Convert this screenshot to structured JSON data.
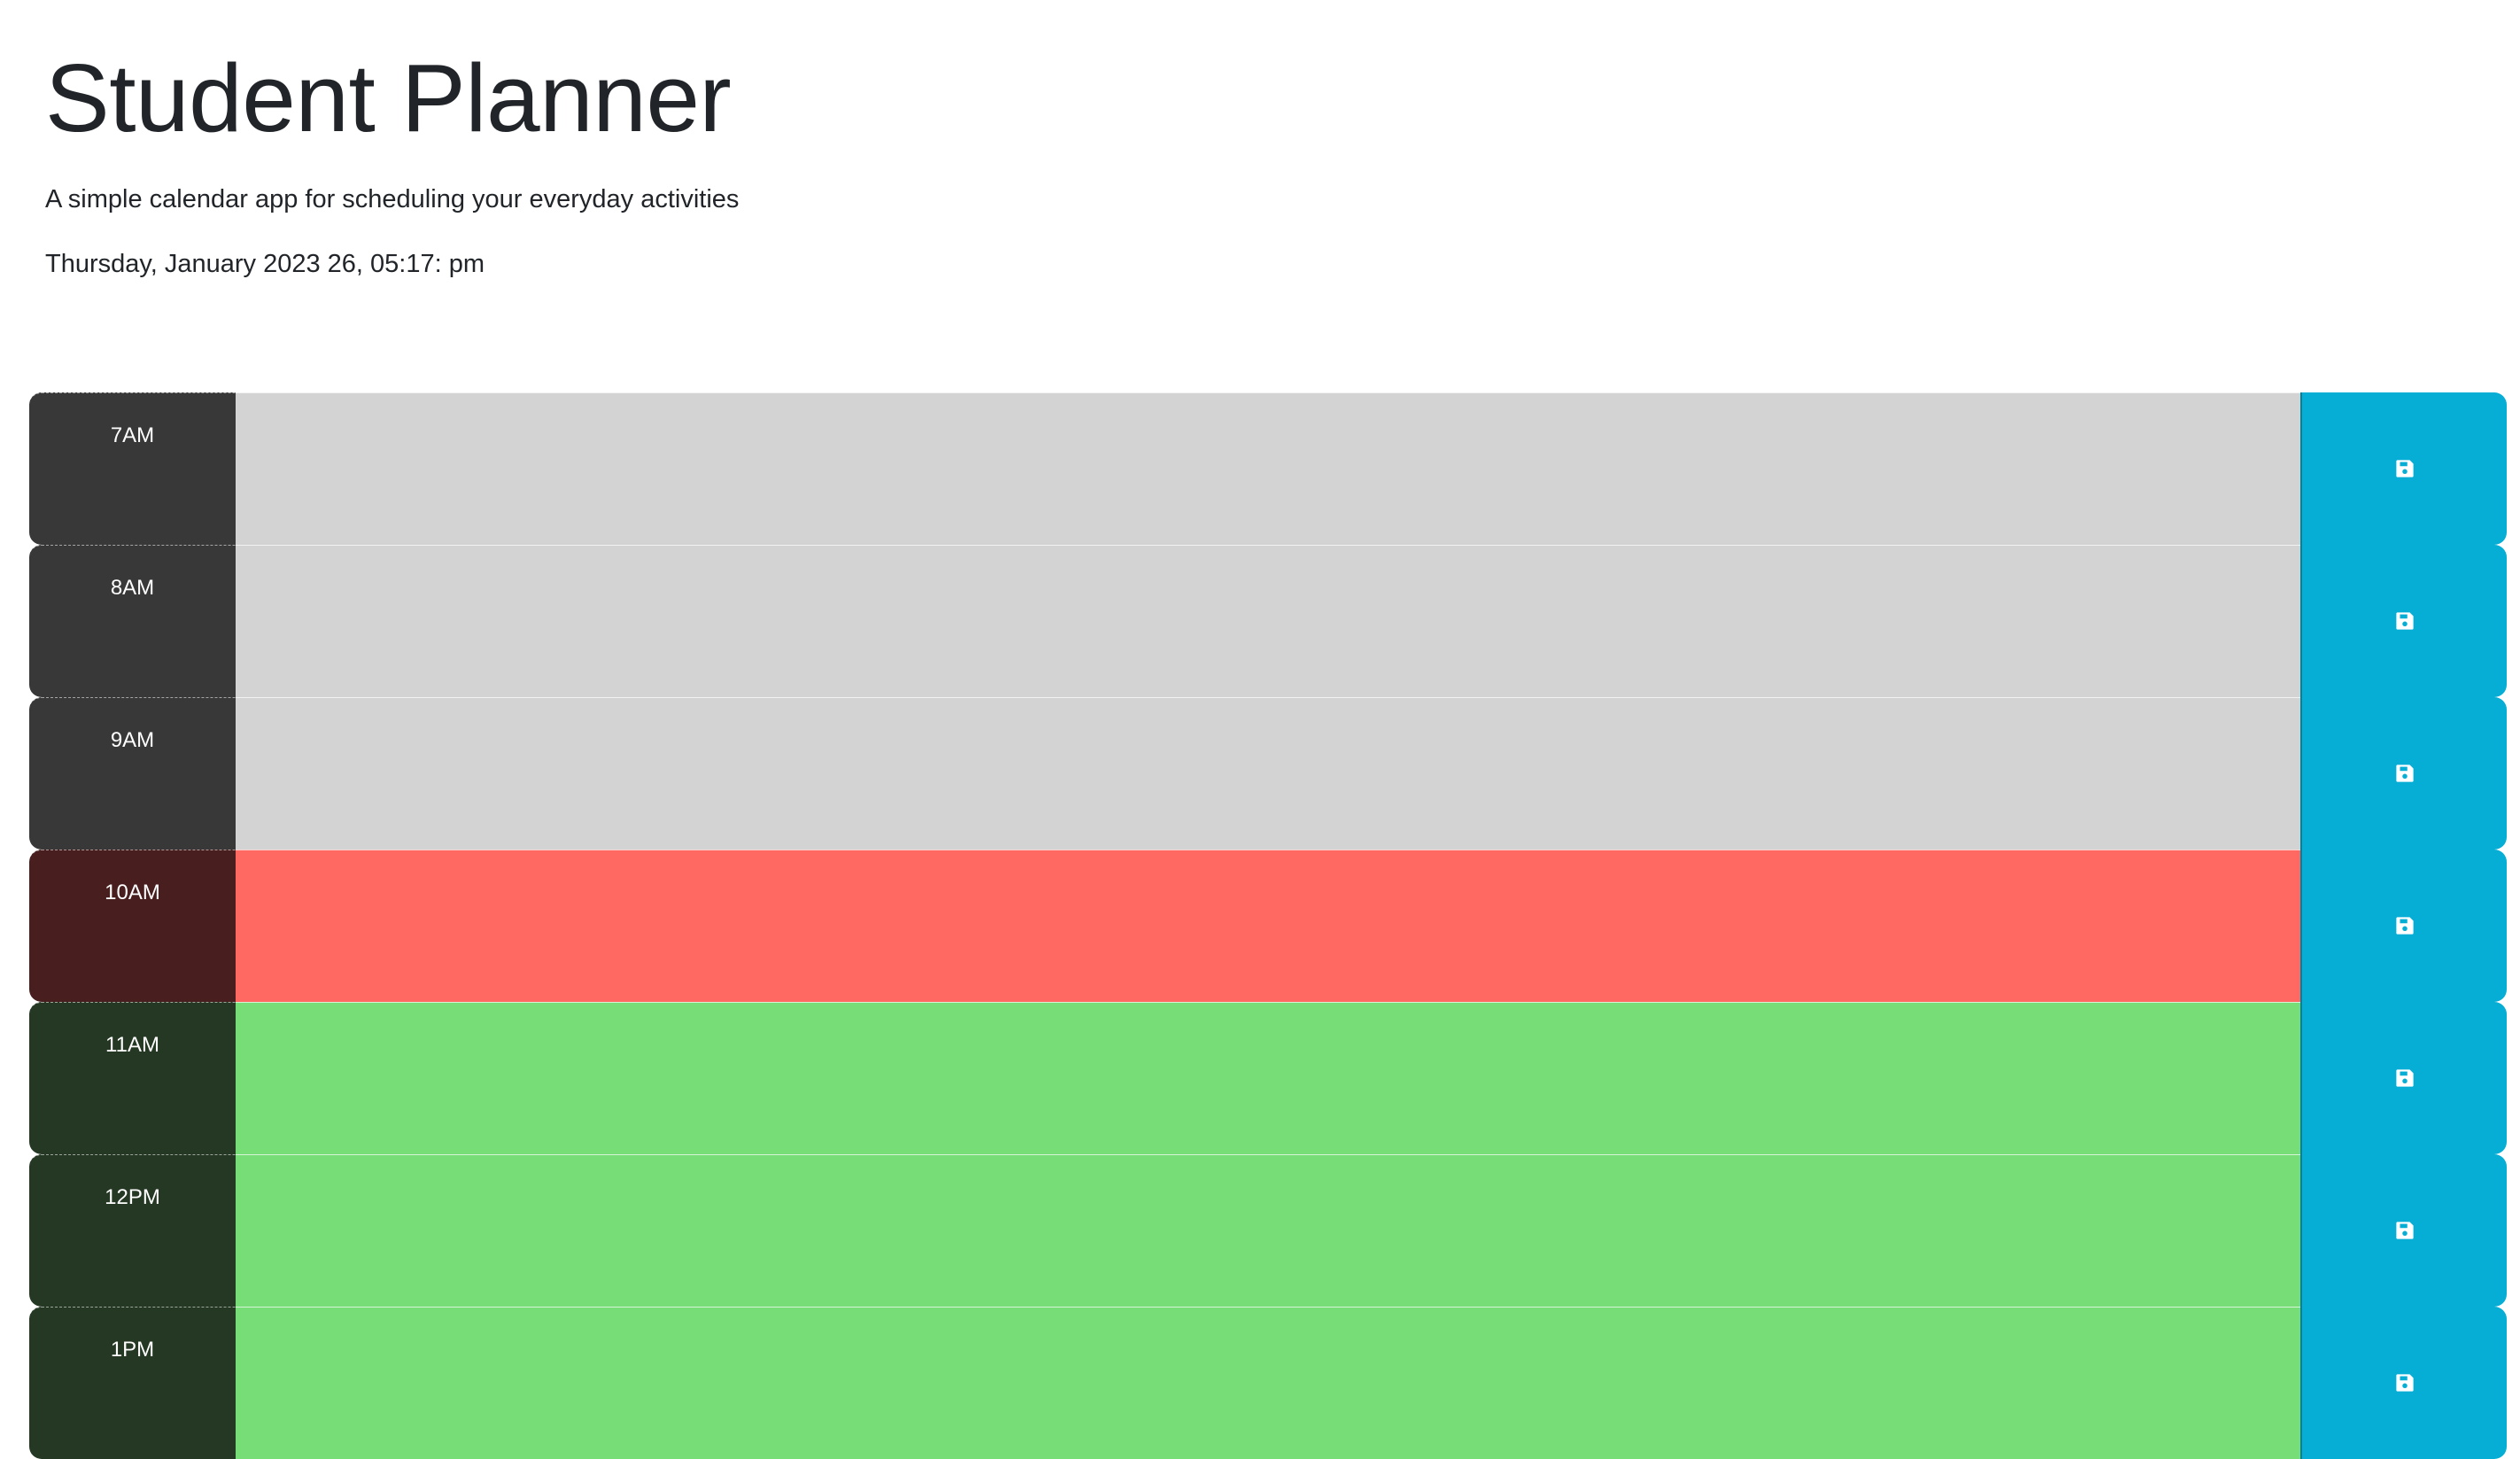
{
  "header": {
    "title": "Student Planner",
    "subtitle": "A simple calendar app for scheduling your everyday activities",
    "datetime": "Thursday, January 2023 26, 05:17: pm"
  },
  "colors": {
    "past": "#d3d3d3",
    "present": "#ff6961",
    "future": "#77dd77",
    "save_button": "#06aed5",
    "hour_past": "#383838",
    "hour_present": "#481f1e",
    "hour_future": "#243823"
  },
  "save_icon": "floppy-disk-icon",
  "time_blocks": [
    {
      "hour": "7AM",
      "state": "past",
      "text": ""
    },
    {
      "hour": "8AM",
      "state": "past",
      "text": ""
    },
    {
      "hour": "9AM",
      "state": "past",
      "text": ""
    },
    {
      "hour": "10AM",
      "state": "present",
      "text": ""
    },
    {
      "hour": "11AM",
      "state": "future",
      "text": ""
    },
    {
      "hour": "12PM",
      "state": "future",
      "text": ""
    },
    {
      "hour": "1PM",
      "state": "future",
      "text": ""
    }
  ]
}
